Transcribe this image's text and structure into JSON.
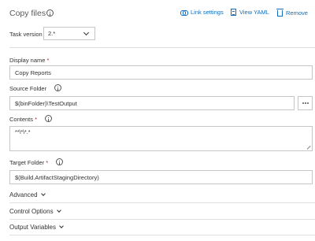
{
  "header": {
    "title": "Copy files",
    "link_settings": "Link settings",
    "view_yaml": "View YAML",
    "remove": "Remove"
  },
  "task_version": {
    "label": "Task version",
    "value": "2.*"
  },
  "fields": {
    "display_name": {
      "label": "Display name",
      "required": "*",
      "value": "Copy Reports"
    },
    "source_folder": {
      "label": "Source Folder",
      "value": "$(binFolder)\\TestOutput"
    },
    "contents": {
      "label": "Contents",
      "required": "*",
      "value": "**\\*\\*.*"
    },
    "target_folder": {
      "label": "Target Folder",
      "required": "*",
      "value": "$(Build.ArtifactStagingDirectory)"
    }
  },
  "sections": {
    "advanced": "Advanced",
    "control_options": "Control Options",
    "output_variables": "Output Variables"
  },
  "colors": {
    "link": "#106ebe",
    "required": "#a4262c",
    "border": "#c8c6c4"
  }
}
